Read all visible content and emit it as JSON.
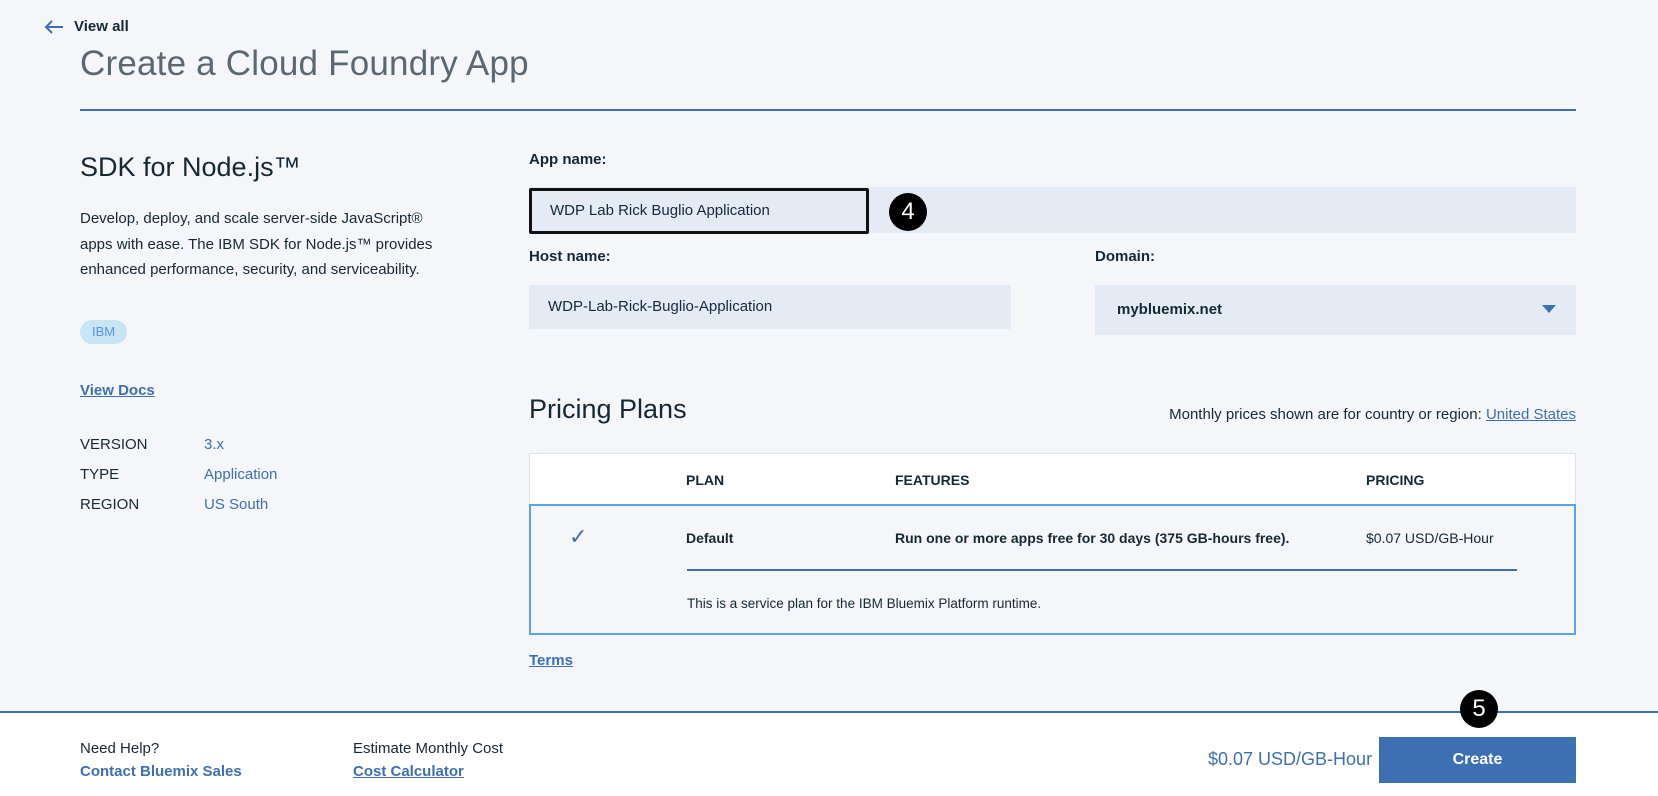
{
  "nav": {
    "back_label": "View all"
  },
  "page": {
    "title": "Create a Cloud Foundry App"
  },
  "sdk": {
    "title": "SDK for Node.js™",
    "description": "Develop, deploy, and scale server-side JavaScript® apps with ease. The IBM SDK for Node.js™ provides enhanced performance, security, and serviceability.",
    "tag": "IBM",
    "view_docs": "View Docs",
    "meta": [
      {
        "key": "VERSION",
        "value": "3.x"
      },
      {
        "key": "TYPE",
        "value": "Application"
      },
      {
        "key": "REGION",
        "value": "US South"
      }
    ]
  },
  "form": {
    "app_name_label": "App name:",
    "app_name_value": "WDP Lab Rick Buglio Application",
    "host_name_label": "Host name:",
    "host_name_value": "WDP-Lab-Rick-Buglio-Application",
    "domain_label": "Domain:",
    "domain_value": "mybluemix.net"
  },
  "steps": {
    "step_app_name": "4",
    "step_create": "5"
  },
  "pricing": {
    "title": "Pricing Plans",
    "region_note": "Monthly prices shown are for country or region: ",
    "region_link": "United States",
    "headers": {
      "plan": "PLAN",
      "features": "FEATURES",
      "pricing": "PRICING"
    },
    "plans": [
      {
        "selected": true,
        "name": "Default",
        "features": "Run one or more apps free for 30 days (375 GB-hours free).",
        "price": "$0.07 USD/GB-Hour",
        "description": "This is a service plan for the IBM Bluemix Platform runtime."
      }
    ],
    "terms": "Terms"
  },
  "footer": {
    "help_label": "Need Help?",
    "help_link": "Contact Bluemix Sales",
    "estimate_label": "Estimate Monthly Cost",
    "estimate_link": "Cost Calculator",
    "total_price": "$0.07 USD/GB-Hour",
    "create_label": "Create"
  },
  "colors": {
    "accent": "#3d70b2",
    "background": "#f4f6fa",
    "field": "#e4ebf5",
    "selected_border": "#5aa3ea"
  },
  "icons": {
    "back": "arrow-left-icon",
    "dropdown": "caret-down-icon",
    "selected": "checkmark-icon"
  }
}
